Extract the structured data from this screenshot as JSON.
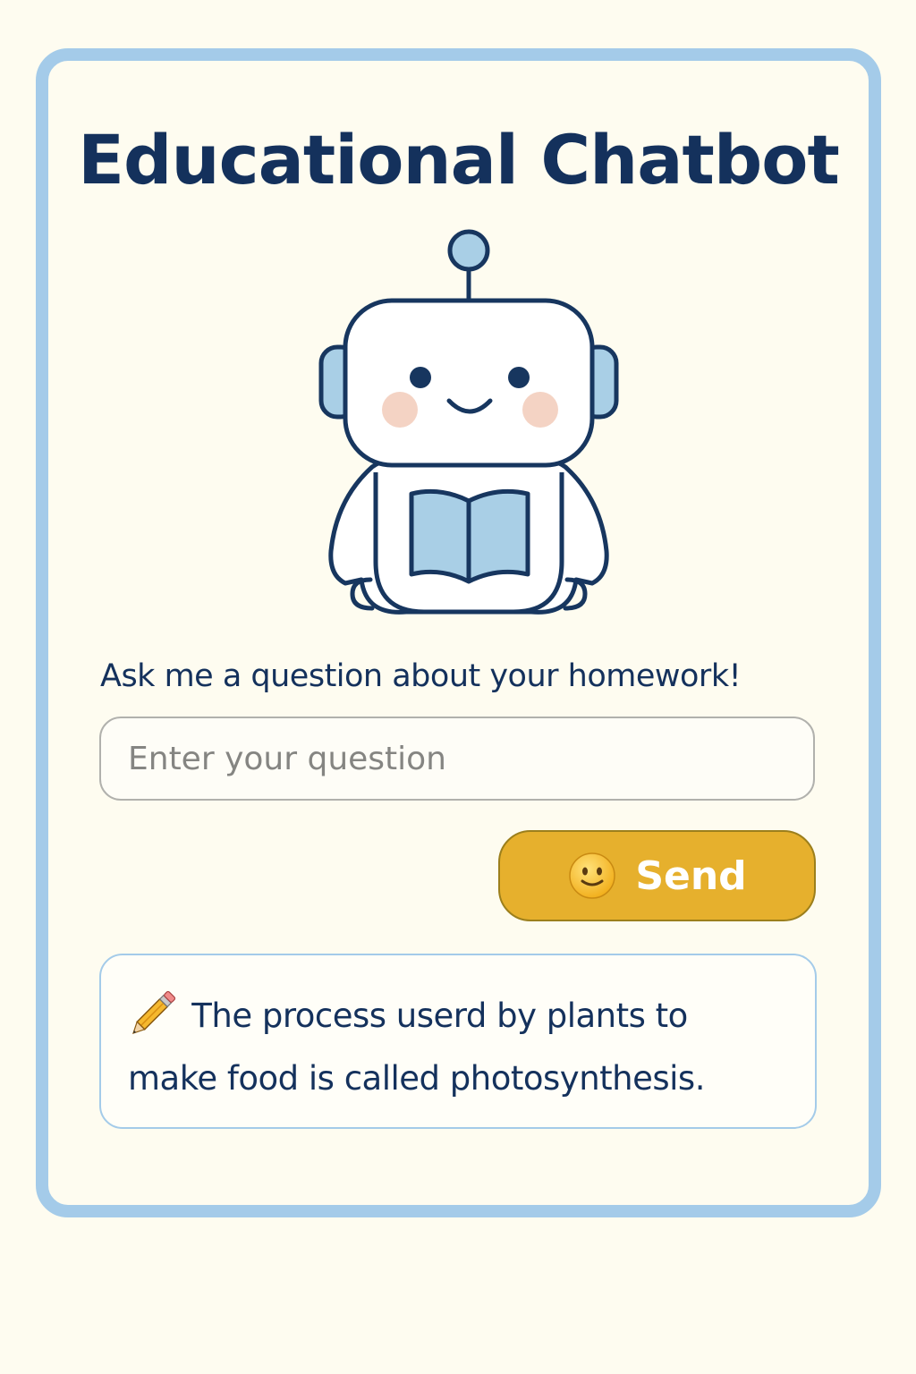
{
  "header": {
    "title": "Educational Chatbot"
  },
  "mascot": {
    "icon": "robot-reading-book-icon"
  },
  "chat": {
    "prompt": "Ask me a question about your homework!",
    "input": {
      "placeholder": "Enter your question",
      "value": ""
    },
    "send_button": {
      "label": "Send",
      "icon": "smiley-face-icon"
    },
    "answer": {
      "icon": "pencil-icon",
      "line1": "The process userd by plants to",
      "line2": "make food is called photosynthesis."
    }
  },
  "colors": {
    "background": "#fefcf0",
    "card_border": "#a4cbe9",
    "text": "#14315c",
    "button": "#e6b02d"
  }
}
